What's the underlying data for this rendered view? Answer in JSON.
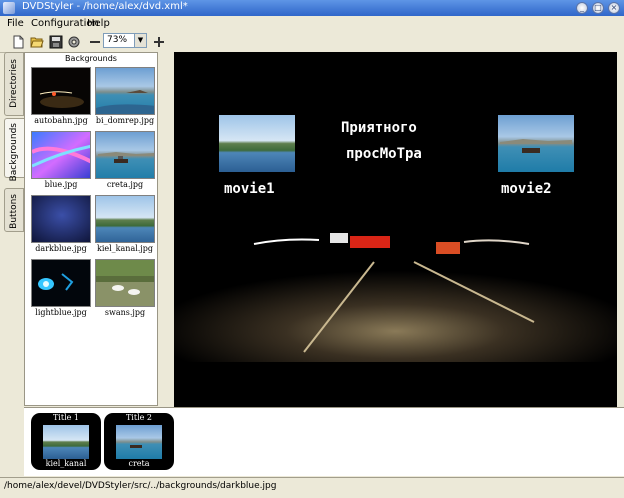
{
  "window": {
    "title": "DVDStyler - /home/alex/dvd.xml*"
  },
  "menu": {
    "file": "File",
    "configuration": "Configuration",
    "help": "Help"
  },
  "toolbar": {
    "zoom_value": "73%"
  },
  "side_tabs": {
    "directories": "Directories",
    "backgrounds": "Backgrounds",
    "buttons": "Buttons"
  },
  "backgrounds_panel": {
    "header": "Backgrounds",
    "items": [
      {
        "label": "autobahn.jpg"
      },
      {
        "label": "bi_domrep.jpg"
      },
      {
        "label": "blue.jpg"
      },
      {
        "label": "creta.jpg"
      },
      {
        "label": "darkblue.jpg"
      },
      {
        "label": "kiel_kanal.jpg"
      },
      {
        "label": "lightblue.jpg"
      },
      {
        "label": "swans.jpg"
      }
    ]
  },
  "menu_canvas": {
    "title_line1": "Приятного",
    "title_line2": "просМоТра",
    "button1_label": "movie1",
    "button2_label": "movie2"
  },
  "titles": [
    {
      "header": "Title 1",
      "caption": "kiel_kanal"
    },
    {
      "header": "Title 2",
      "caption": "creta"
    }
  ],
  "status": {
    "text": "/home/alex/devel/DVDStyler/src/../backgrounds/darkblue.jpg"
  }
}
